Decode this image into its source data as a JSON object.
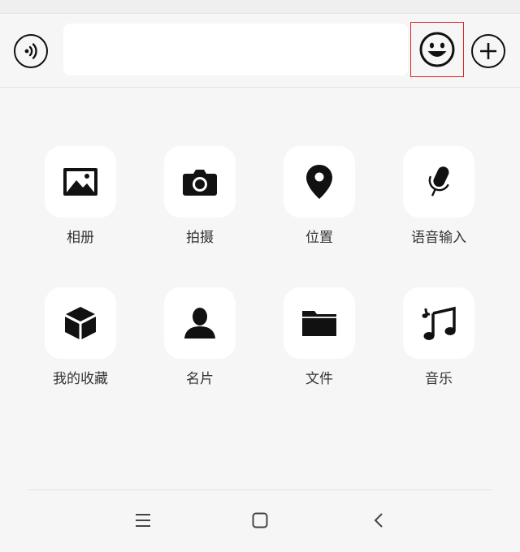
{
  "input_bar": {
    "voice_icon": "voice-wave-icon",
    "text_value": "",
    "emoji_icon": "smiley-icon",
    "plus_icon": "plus-circle-icon",
    "highlight_color": "#dd2222"
  },
  "panel": {
    "items": [
      {
        "label": "相册",
        "icon": "photo-album-icon"
      },
      {
        "label": "拍摄",
        "icon": "camera-icon"
      },
      {
        "label": "位置",
        "icon": "location-pin-icon"
      },
      {
        "label": "语音输入",
        "icon": "microphone-icon"
      },
      {
        "label": "我的收藏",
        "icon": "cube-icon"
      },
      {
        "label": "名片",
        "icon": "person-icon"
      },
      {
        "label": "文件",
        "icon": "folder-icon"
      },
      {
        "label": "音乐",
        "icon": "music-note-icon"
      }
    ]
  },
  "nav": {
    "menu_icon": "menu-icon",
    "home_icon": "home-square-icon",
    "back_icon": "back-chevron-icon"
  }
}
